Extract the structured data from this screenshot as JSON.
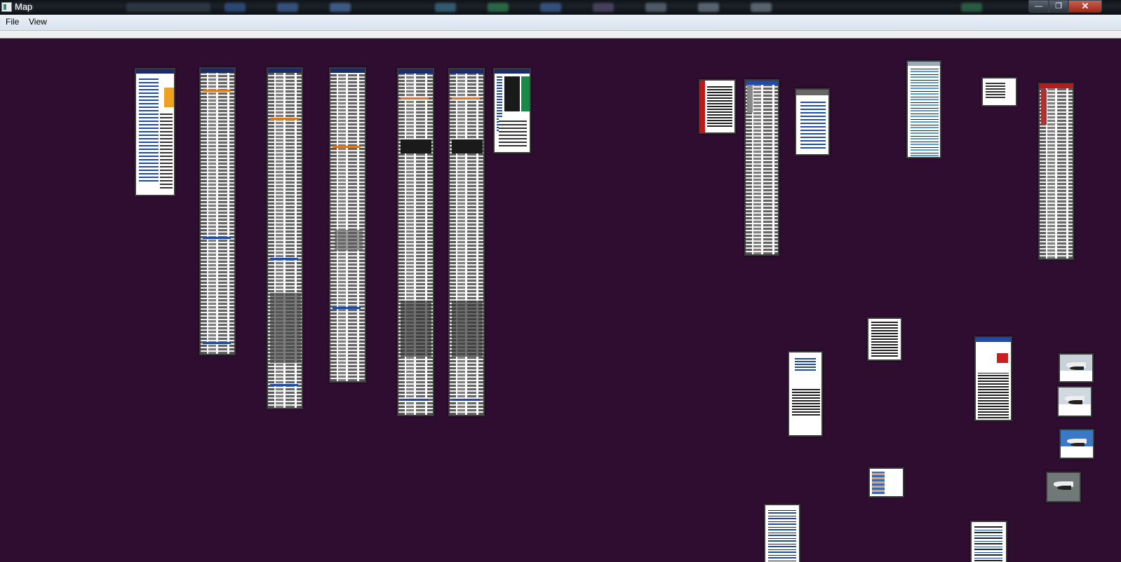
{
  "window": {
    "title": "Map",
    "minimize": "—",
    "maximize": "❐",
    "close": "✕"
  },
  "menu": {
    "items": [
      "File",
      "View"
    ]
  },
  "canvas": {
    "background": "#2e0d30"
  },
  "thumbnails": [
    {
      "name": "page-thumbnail",
      "kind": "portal"
    },
    {
      "name": "page-thumbnail",
      "kind": "long"
    },
    {
      "name": "page-thumbnail",
      "kind": "long"
    },
    {
      "name": "page-thumbnail",
      "kind": "long"
    },
    {
      "name": "page-thumbnail",
      "kind": "long"
    },
    {
      "name": "page-thumbnail",
      "kind": "long"
    },
    {
      "name": "page-thumbnail",
      "kind": "portal"
    },
    {
      "name": "page-thumbnail",
      "kind": "article"
    },
    {
      "name": "page-thumbnail",
      "kind": "long"
    },
    {
      "name": "page-thumbnail",
      "kind": "article"
    },
    {
      "name": "page-thumbnail",
      "kind": "list"
    },
    {
      "name": "page-thumbnail",
      "kind": "article"
    },
    {
      "name": "page-thumbnail",
      "kind": "long"
    },
    {
      "name": "page-thumbnail",
      "kind": "article"
    },
    {
      "name": "page-thumbnail",
      "kind": "article"
    },
    {
      "name": "page-thumbnail",
      "kind": "portal"
    },
    {
      "name": "photo-thumbnail",
      "kind": "photo"
    },
    {
      "name": "photo-thumbnail",
      "kind": "photo"
    },
    {
      "name": "photo-thumbnail",
      "kind": "photo"
    },
    {
      "name": "photo-thumbnail",
      "kind": "photo"
    },
    {
      "name": "page-thumbnail",
      "kind": "article"
    },
    {
      "name": "page-thumbnail",
      "kind": "article"
    },
    {
      "name": "page-thumbnail",
      "kind": "article"
    }
  ]
}
